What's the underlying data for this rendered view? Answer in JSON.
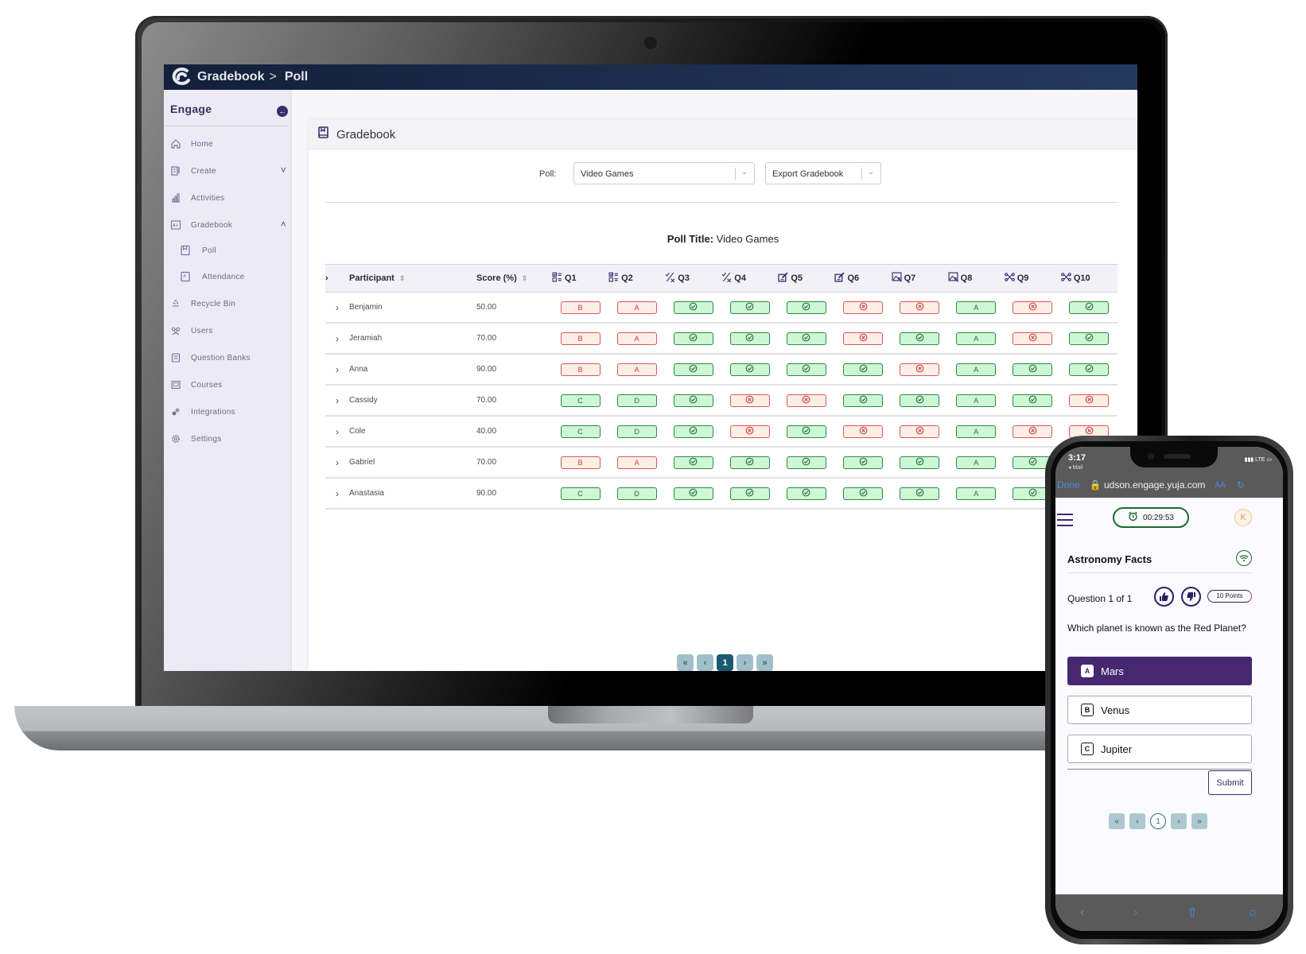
{
  "laptop": {
    "breadcrumb": {
      "root": "Gradebook",
      "separator": ">",
      "current": "Poll"
    },
    "sidebar": {
      "title": "Engage",
      "collapse_icon": "arrow-left-icon",
      "items": [
        {
          "label": "Home",
          "icon": "home-icon"
        },
        {
          "label": "Create",
          "icon": "create-icon",
          "chevron": "down"
        },
        {
          "label": "Activities",
          "icon": "bar-chart-icon"
        },
        {
          "label": "Gradebook",
          "icon": "gradebook-icon",
          "chevron": "up"
        },
        {
          "label": "Poll",
          "icon": "book-icon",
          "sub": true
        },
        {
          "label": "Attendance",
          "icon": "attendance-icon",
          "sub": true
        },
        {
          "label": "Recycle Bin",
          "icon": "recycle-icon"
        },
        {
          "label": "Users",
          "icon": "users-icon"
        },
        {
          "label": "Question Banks",
          "icon": "question-bank-icon"
        },
        {
          "label": "Courses",
          "icon": "courses-icon"
        },
        {
          "label": "Integrations",
          "icon": "integrations-icon"
        },
        {
          "label": "Settings",
          "icon": "gear-icon"
        }
      ]
    },
    "card": {
      "title": "Gradebook",
      "poll_label": "Poll:",
      "poll_select": "Video Games",
      "export_select": "Export Gradebook",
      "poll_title_label": "Poll Title:",
      "poll_title_value": "Video Games"
    },
    "table": {
      "columns": {
        "participant": "Participant",
        "score": "Score (%)",
        "questions": [
          {
            "label": "Q1",
            "icon": "multiple-choice-icon"
          },
          {
            "label": "Q2",
            "icon": "multiple-choice-icon"
          },
          {
            "label": "Q3",
            "icon": "true-false-icon"
          },
          {
            "label": "Q4",
            "icon": "true-false-icon"
          },
          {
            "label": "Q5",
            "icon": "short-answer-icon"
          },
          {
            "label": "Q6",
            "icon": "short-answer-icon"
          },
          {
            "label": "Q7",
            "icon": "image-target-icon"
          },
          {
            "label": "Q8",
            "icon": "image-target-icon"
          },
          {
            "label": "Q9",
            "icon": "matching-icon"
          },
          {
            "label": "Q10",
            "icon": "matching-icon"
          }
        ]
      },
      "rows": [
        {
          "name": "Benjamin",
          "score": "50.00",
          "answers": [
            [
              "B",
              "wrong"
            ],
            [
              "A",
              "wrong"
            ],
            [
              "check",
              "correct"
            ],
            [
              "check",
              "correct"
            ],
            [
              "check",
              "correct"
            ],
            [
              "x",
              "wrong"
            ],
            [
              "x",
              "wrong"
            ],
            [
              "A",
              "correct"
            ],
            [
              "x",
              "wrong"
            ],
            [
              "check",
              "correct"
            ]
          ]
        },
        {
          "name": "Jeramiah",
          "score": "70.00",
          "answers": [
            [
              "B",
              "wrong"
            ],
            [
              "A",
              "wrong"
            ],
            [
              "check",
              "correct"
            ],
            [
              "check",
              "correct"
            ],
            [
              "check",
              "correct"
            ],
            [
              "x",
              "wrong"
            ],
            [
              "check",
              "correct"
            ],
            [
              "A",
              "correct"
            ],
            [
              "x",
              "wrong"
            ],
            [
              "check",
              "correct"
            ]
          ]
        },
        {
          "name": "Anna",
          "score": "90.00",
          "answers": [
            [
              "B",
              "wrong"
            ],
            [
              "A",
              "wrong"
            ],
            [
              "check",
              "correct"
            ],
            [
              "check",
              "correct"
            ],
            [
              "check",
              "correct"
            ],
            [
              "check",
              "correct"
            ],
            [
              "x",
              "wrong"
            ],
            [
              "A",
              "correct"
            ],
            [
              "check",
              "correct"
            ],
            [
              "check",
              "correct"
            ]
          ]
        },
        {
          "name": "Cassidy",
          "score": "70.00",
          "answers": [
            [
              "C",
              "correct"
            ],
            [
              "D",
              "correct"
            ],
            [
              "check",
              "correct"
            ],
            [
              "x",
              "wrong"
            ],
            [
              "x",
              "wrong"
            ],
            [
              "check",
              "correct"
            ],
            [
              "check",
              "correct"
            ],
            [
              "A",
              "correct"
            ],
            [
              "check",
              "correct"
            ],
            [
              "x",
              "wrong"
            ]
          ]
        },
        {
          "name": "Cole",
          "score": "40.00",
          "answers": [
            [
              "C",
              "correct"
            ],
            [
              "D",
              "correct"
            ],
            [
              "check",
              "correct"
            ],
            [
              "x",
              "wrong"
            ],
            [
              "check",
              "correct"
            ],
            [
              "x",
              "wrong"
            ],
            [
              "x",
              "wrong"
            ],
            [
              "A",
              "correct"
            ],
            [
              "x",
              "wrong"
            ],
            [
              "x",
              "wrong"
            ]
          ]
        },
        {
          "name": "Gabriel",
          "score": "70.00",
          "answers": [
            [
              "B",
              "wrong"
            ],
            [
              "A",
              "wrong"
            ],
            [
              "check",
              "correct"
            ],
            [
              "check",
              "correct"
            ],
            [
              "check",
              "correct"
            ],
            [
              "check",
              "correct"
            ],
            [
              "check",
              "correct"
            ],
            [
              "A",
              "correct"
            ],
            [
              "check",
              "correct"
            ],
            null
          ]
        },
        {
          "name": "Anastasia",
          "score": "90.00",
          "answers": [
            [
              "C",
              "correct"
            ],
            [
              "D",
              "correct"
            ],
            [
              "check",
              "correct"
            ],
            [
              "check",
              "correct"
            ],
            [
              "check",
              "correct"
            ],
            [
              "check",
              "correct"
            ],
            [
              "check",
              "correct"
            ],
            [
              "A",
              "correct"
            ],
            [
              "check",
              "correct"
            ],
            null
          ]
        }
      ]
    },
    "pagination": {
      "first": "«",
      "prev": "‹",
      "current": "1",
      "next": "›",
      "last": "»"
    },
    "colors": {
      "correct_bg": "#cdf7d6",
      "correct_border": "#2e8b3e",
      "wrong_bg": "#fdeee6",
      "wrong_border": "#d65a5a",
      "accent": "#3c2b6b",
      "pager_active": "#1a5a6f"
    }
  },
  "phone": {
    "status": {
      "time": "3:17",
      "back_app": "◂ Mail",
      "network": "LTE"
    },
    "browser": {
      "done": "Done",
      "url": "udson.engage.yuja.com",
      "text_size": "AA"
    },
    "timer": "00:29:53",
    "avatar_initial": "K",
    "activity_title": "Astronomy Facts",
    "question_counter": "Question 1 of 1",
    "points": "10 Points",
    "question": "Which planet is known as the Red Planet?",
    "options": [
      {
        "letter": "A",
        "text": "Mars",
        "selected": true
      },
      {
        "letter": "B",
        "text": "Venus",
        "selected": false
      },
      {
        "letter": "C",
        "text": "Jupiter",
        "selected": false
      }
    ],
    "submit": "Submit",
    "pagination": {
      "first": "«",
      "prev": "‹",
      "current": "1",
      "next": "›",
      "last": "»"
    },
    "colors": {
      "selected_option": "#45286f",
      "timer_border": "#1b6b2b"
    }
  }
}
